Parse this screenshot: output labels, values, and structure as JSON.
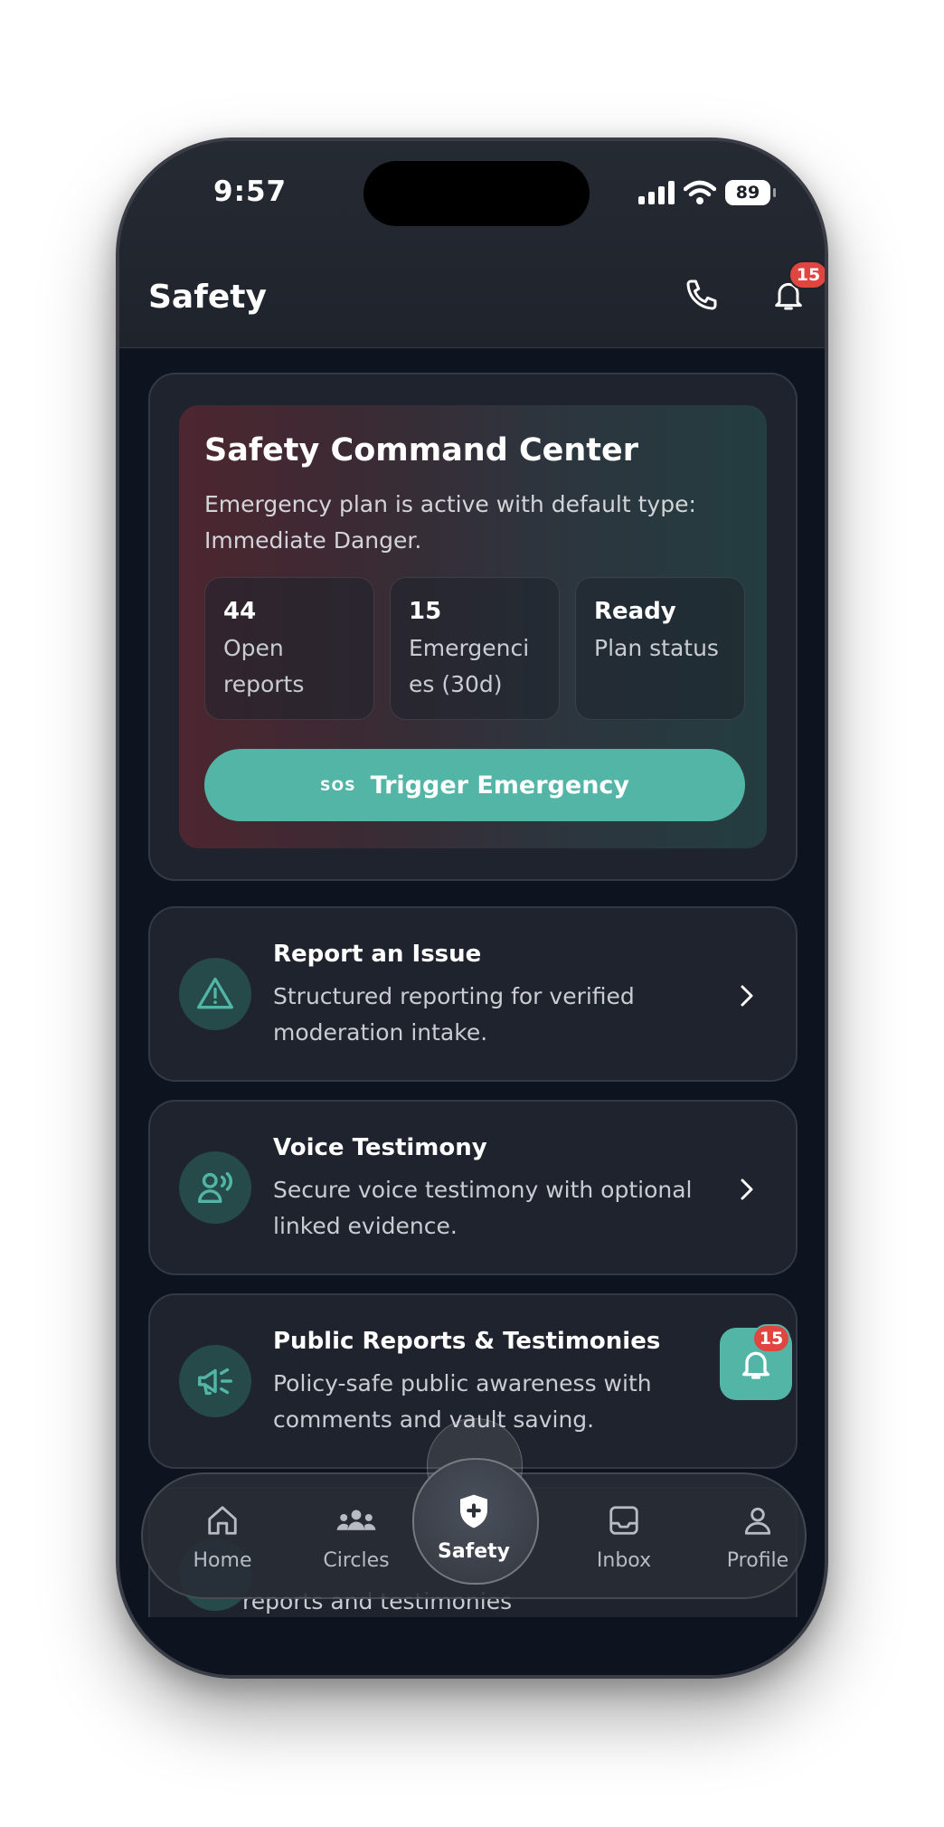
{
  "status_bar": {
    "time": "9:57",
    "battery": "89"
  },
  "header": {
    "title": "Safety",
    "notification_count": "15"
  },
  "command_center": {
    "title": "Safety Command Center",
    "subtitle": "Emergency plan is active with default type: Immediate Danger.",
    "stats": [
      {
        "value": "44",
        "label": "Open reports"
      },
      {
        "value": "15",
        "label": "Emergencies (30d)"
      },
      {
        "value": "Ready",
        "label": "Plan status"
      }
    ],
    "sos_glyph": "SOS",
    "button_label": "Trigger Emergency"
  },
  "actions": [
    {
      "title": "Report an Issue",
      "description": "Structured reporting for verified moderation intake.",
      "icon": "warning-triangle-icon"
    },
    {
      "title": "Voice Testimony",
      "description": "Secure voice testimony with optional linked evidence.",
      "icon": "voice-person-icon"
    },
    {
      "title": "Public Reports & Testimonies",
      "description": "Policy-safe public awareness with comments and vault saving.",
      "icon": "megaphone-icon"
    }
  ],
  "partial_row_text": "reports and testimonies",
  "floating_notifications": {
    "count": "15"
  },
  "nav": {
    "items": [
      {
        "label": "Home",
        "icon": "home-icon"
      },
      {
        "label": "Circles",
        "icon": "people-icon"
      },
      {
        "label": "Safety",
        "icon": "shield-plus-icon"
      },
      {
        "label": "Inbox",
        "icon": "inbox-icon"
      },
      {
        "label": "Profile",
        "icon": "person-icon"
      }
    ],
    "active": "Safety"
  },
  "colors": {
    "accent": "#52b5a6",
    "background": "#0e1320",
    "card": "#1f232d",
    "badge": "#e0463f"
  }
}
